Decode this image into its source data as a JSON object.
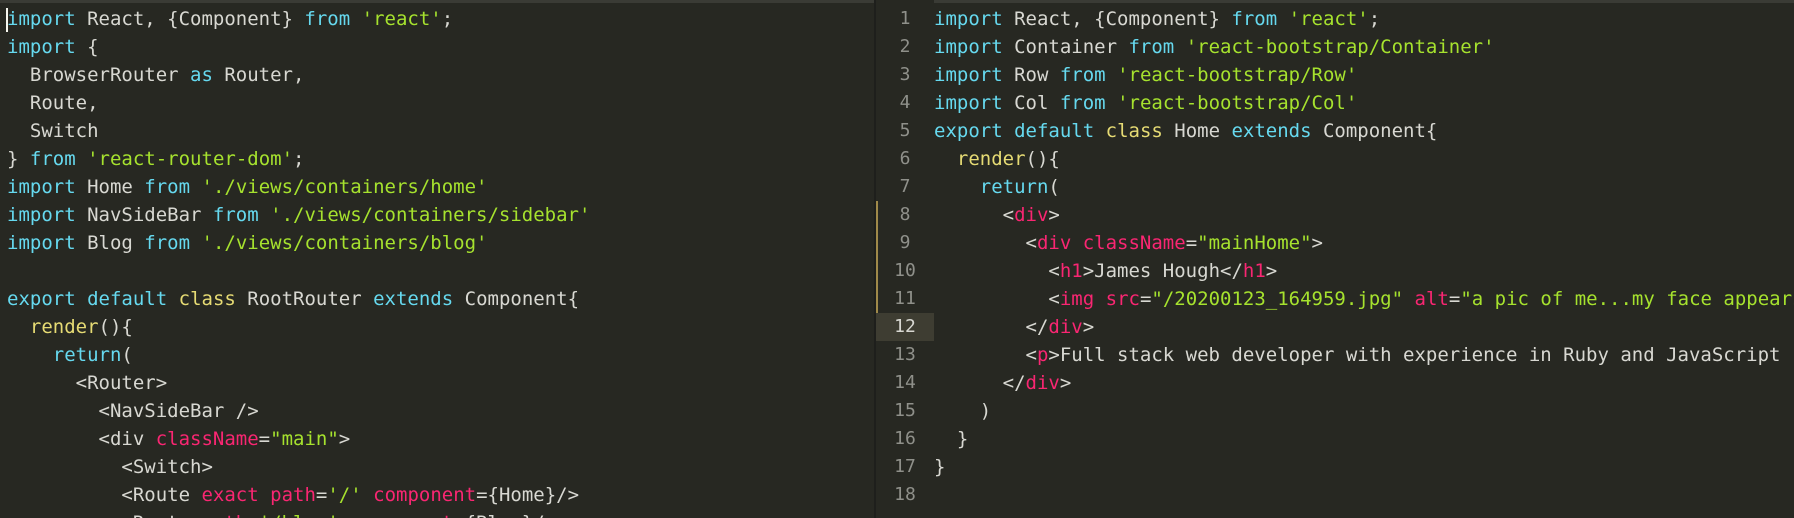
{
  "colors": {
    "background": "#272822",
    "text": "#d8d8d2",
    "keyword": "#66d9ef",
    "string": "#a6e22e",
    "attribute": "#f92672",
    "identifier_yellow": "#e6db74",
    "line_number": "#8f908a",
    "active_line": "#3e3d32",
    "modified_marker": "#a08a4a"
  },
  "left_pane": {
    "lines": [
      [
        [
          "kw",
          "import"
        ],
        [
          "t",
          " React, {Component} "
        ],
        [
          "kw",
          "from"
        ],
        [
          "t",
          " "
        ],
        [
          "str",
          "'react'"
        ],
        [
          "t",
          ";"
        ]
      ],
      [
        [
          "kw",
          "import"
        ],
        [
          "t",
          " {"
        ]
      ],
      [
        [
          "t",
          "  BrowserRouter "
        ],
        [
          "kw",
          "as"
        ],
        [
          "t",
          " Router,"
        ]
      ],
      [
        [
          "t",
          "  Route,"
        ]
      ],
      [
        [
          "t",
          "  Switch"
        ]
      ],
      [
        [
          "t",
          "} "
        ],
        [
          "kw",
          "from"
        ],
        [
          "t",
          " "
        ],
        [
          "str",
          "'react-router-dom'"
        ],
        [
          "t",
          ";"
        ]
      ],
      [
        [
          "kw",
          "import"
        ],
        [
          "t",
          " Home "
        ],
        [
          "kw",
          "from"
        ],
        [
          "t",
          " "
        ],
        [
          "str",
          "'./views/containers/home'"
        ]
      ],
      [
        [
          "kw",
          "import"
        ],
        [
          "t",
          " NavSideBar "
        ],
        [
          "kw",
          "from"
        ],
        [
          "t",
          " "
        ],
        [
          "str",
          "'./views/containers/sidebar'"
        ]
      ],
      [
        [
          "kw",
          "import"
        ],
        [
          "t",
          " Blog "
        ],
        [
          "kw",
          "from"
        ],
        [
          "t",
          " "
        ],
        [
          "str",
          "'./views/containers/blog'"
        ]
      ],
      [
        [
          "t",
          ""
        ]
      ],
      [
        [
          "kw",
          "export"
        ],
        [
          "t",
          " "
        ],
        [
          "kw",
          "default"
        ],
        [
          "t",
          " "
        ],
        [
          "yel",
          "class"
        ],
        [
          "t",
          " RootRouter "
        ],
        [
          "kw",
          "extends"
        ],
        [
          "t",
          " Component{"
        ]
      ],
      [
        [
          "t",
          "  "
        ],
        [
          "yel",
          "render"
        ],
        [
          "t",
          "(){"
        ]
      ],
      [
        [
          "t",
          "    "
        ],
        [
          "kw",
          "return"
        ],
        [
          "t",
          "("
        ]
      ],
      [
        [
          "t",
          "      <Router>"
        ]
      ],
      [
        [
          "t",
          "        <NavSideBar />"
        ]
      ],
      [
        [
          "t",
          "        <div "
        ],
        [
          "attr",
          "className"
        ],
        [
          "t",
          "="
        ],
        [
          "str",
          "\"main\""
        ],
        [
          "t",
          ">"
        ]
      ],
      [
        [
          "t",
          "          <Switch>"
        ]
      ],
      [
        [
          "t",
          "          <Route "
        ],
        [
          "attr",
          "exact"
        ],
        [
          "t",
          " "
        ],
        [
          "attr",
          "path"
        ],
        [
          "t",
          "="
        ],
        [
          "str",
          "'/'"
        ],
        [
          "t",
          " "
        ],
        [
          "attr",
          "component"
        ],
        [
          "t",
          "={Home}/>"
        ]
      ],
      [
        [
          "t",
          "          <Route "
        ],
        [
          "attr",
          "path"
        ],
        [
          "t",
          "="
        ],
        [
          "str",
          "'/blog'"
        ],
        [
          "t",
          " "
        ],
        [
          "attr",
          "component"
        ],
        [
          "t",
          "={Blog}/>"
        ]
      ]
    ]
  },
  "right_pane": {
    "line_numbers": [
      "1",
      "2",
      "3",
      "4",
      "5",
      "6",
      "7",
      "8",
      "9",
      "10",
      "11",
      "12",
      "13",
      "14",
      "15",
      "16",
      "17",
      "18"
    ],
    "active_line_index": 11,
    "modified_line_indexes": [
      7,
      8,
      9,
      10
    ],
    "lines": [
      [
        [
          "kw",
          "import"
        ],
        [
          "t",
          " React, {Component} "
        ],
        [
          "kw",
          "from"
        ],
        [
          "t",
          " "
        ],
        [
          "str",
          "'react'"
        ],
        [
          "t",
          ";"
        ]
      ],
      [
        [
          "kw",
          "import"
        ],
        [
          "t",
          " Container "
        ],
        [
          "kw",
          "from"
        ],
        [
          "t",
          " "
        ],
        [
          "str",
          "'react-bootstrap/Container'"
        ]
      ],
      [
        [
          "kw",
          "import"
        ],
        [
          "t",
          " Row "
        ],
        [
          "kw",
          "from"
        ],
        [
          "t",
          " "
        ],
        [
          "str",
          "'react-bootstrap/Row'"
        ]
      ],
      [
        [
          "kw",
          "import"
        ],
        [
          "t",
          " Col "
        ],
        [
          "kw",
          "from"
        ],
        [
          "t",
          " "
        ],
        [
          "str",
          "'react-bootstrap/Col'"
        ]
      ],
      [
        [
          "kw",
          "export"
        ],
        [
          "t",
          " "
        ],
        [
          "kw",
          "default"
        ],
        [
          "t",
          " "
        ],
        [
          "yel",
          "class"
        ],
        [
          "t",
          " Home "
        ],
        [
          "kw",
          "extends"
        ],
        [
          "t",
          " Component{"
        ]
      ],
      [
        [
          "t",
          "  "
        ],
        [
          "yel",
          "render"
        ],
        [
          "t",
          "(){"
        ]
      ],
      [
        [
          "t",
          "    "
        ],
        [
          "kw",
          "return"
        ],
        [
          "t",
          "("
        ]
      ],
      [
        [
          "t",
          "      <"
        ],
        [
          "pink",
          "div"
        ],
        [
          "t",
          ">"
        ]
      ],
      [
        [
          "t",
          "        <"
        ],
        [
          "pink",
          "div"
        ],
        [
          "t",
          " "
        ],
        [
          "attr",
          "className"
        ],
        [
          "t",
          "="
        ],
        [
          "str",
          "\"mainHome\""
        ],
        [
          "t",
          ">"
        ]
      ],
      [
        [
          "t",
          "          <"
        ],
        [
          "pink",
          "h1"
        ],
        [
          "t",
          ">James Hough</"
        ],
        [
          "pink",
          "h1"
        ],
        [
          "t",
          ">"
        ]
      ],
      [
        [
          "t",
          "          <"
        ],
        [
          "pink",
          "img"
        ],
        [
          "t",
          " "
        ],
        [
          "attr",
          "src"
        ],
        [
          "t",
          "="
        ],
        [
          "str",
          "\"/20200123_164959.jpg\""
        ],
        [
          "t",
          " "
        ],
        [
          "attr",
          "alt"
        ],
        [
          "t",
          "="
        ],
        [
          "str",
          "\"a pic of me...my face appears"
        ]
      ],
      [
        [
          "t",
          "        </"
        ],
        [
          "pink",
          "div"
        ],
        [
          "t",
          ">"
        ]
      ],
      [
        [
          "t",
          "        <"
        ],
        [
          "pink",
          "p"
        ],
        [
          "t",
          ">Full stack web developer with experience in Ruby and JavaScript"
        ]
      ],
      [
        [
          "t",
          "      </"
        ],
        [
          "pink",
          "div"
        ],
        [
          "t",
          ">"
        ]
      ],
      [
        [
          "t",
          "    )"
        ]
      ],
      [
        [
          "t",
          "  }"
        ]
      ],
      [
        [
          "t",
          "}"
        ]
      ],
      [
        [
          "t",
          ""
        ]
      ]
    ]
  }
}
